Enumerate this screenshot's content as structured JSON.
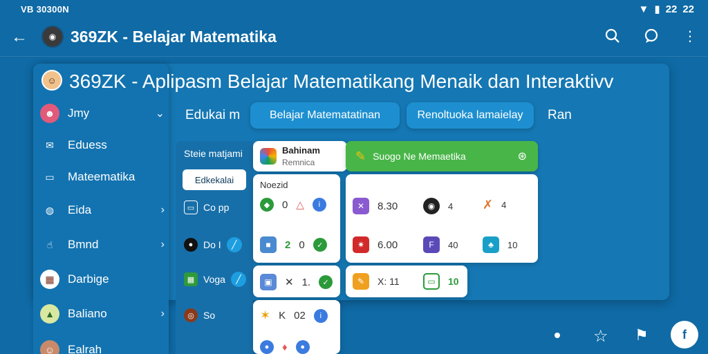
{
  "status": {
    "left": "VB 30300N",
    "right": "22"
  },
  "app_bar": {
    "title": "369ZK - Belajar Matematika",
    "back_icon": "arrow-back-icon",
    "actions": [
      "search-icon",
      "chat-icon",
      "more-vert-icon"
    ]
  },
  "main": {
    "heading": "369ZK - Aplipasm Belajar Matematikang Menaik dan Interaktivv"
  },
  "sidebar": {
    "items": [
      {
        "label": "Jmy",
        "icon": "face-icon",
        "chevron": true
      },
      {
        "label": "Eduess",
        "icon": "mail-icon",
        "chevron": false
      },
      {
        "label": "Mateematika",
        "icon": "card-icon",
        "chevron": false
      },
      {
        "label": "Eida",
        "icon": "globe-icon",
        "chevron": true
      },
      {
        "label": "Bmnd",
        "icon": "hand-icon",
        "chevron": true
      },
      {
        "label": "Darbige",
        "icon": "calculator-icon",
        "chevron": false
      },
      {
        "label": "Baliano",
        "icon": "landscape-icon",
        "chevron": true
      },
      {
        "label": "Ealrah",
        "icon": "person-icon",
        "chevron": false
      }
    ]
  },
  "tabs": [
    {
      "label": "Edukai m"
    },
    {
      "label": "Belajar Matematatinan"
    },
    {
      "label": "Renoltuoka lamaielay"
    },
    {
      "label": "Ran"
    }
  ],
  "sub_panel": {
    "title": "Steie matjami",
    "chip": "Edkekalai",
    "rows": [
      {
        "label": "Co pp"
      },
      {
        "label": "Do I"
      },
      {
        "label": "Voga"
      },
      {
        "label": "So"
      }
    ]
  },
  "cards": {
    "header": {
      "title": "Bahinam",
      "subtitle": "Remnica"
    },
    "section": "Noezid",
    "col1": [
      {
        "a": "0",
        "b": ""
      },
      {
        "a": "2",
        "b": "0"
      },
      {
        "a": "1.",
        "b": ""
      },
      {
        "a": "K",
        "b": "02"
      }
    ],
    "banner": "Suogo Ne Memaetika",
    "grid": [
      {
        "value": "8.30"
      },
      {
        "value": "4"
      },
      {
        "value": "4"
      },
      {
        "value": "6.00"
      },
      {
        "value": "40"
      },
      {
        "value": "10"
      },
      {
        "value": "X: 11"
      },
      {
        "value": "10"
      }
    ]
  },
  "bottom_actions": [
    "dot-icon",
    "star-icon",
    "bookmark-icon",
    "share-icon"
  ]
}
